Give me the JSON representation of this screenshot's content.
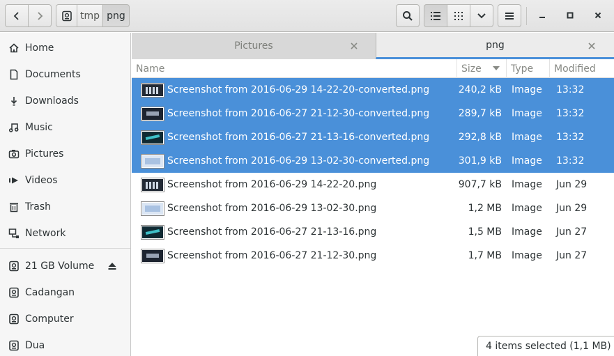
{
  "header": {
    "back_icon": "chevron-left-icon",
    "forward_icon": "chevron-right-icon",
    "path": [
      "tmp",
      "png"
    ],
    "path_root_icon": "drive-icon",
    "search_icon": "search-icon",
    "list_view_icon": "list-icon",
    "grid_view_icon": "grid-icon",
    "view_options_icon": "chevron-down-icon",
    "menu_icon": "hamburger-icon"
  },
  "sidebar": {
    "places": [
      {
        "label": "Home",
        "icon": "home-icon"
      },
      {
        "label": "Documents",
        "icon": "document-icon"
      },
      {
        "label": "Downloads",
        "icon": "download-icon"
      },
      {
        "label": "Music",
        "icon": "music-icon"
      },
      {
        "label": "Pictures",
        "icon": "camera-icon"
      },
      {
        "label": "Videos",
        "icon": "video-icon"
      },
      {
        "label": "Trash",
        "icon": "trash-icon"
      },
      {
        "label": "Network",
        "icon": "network-icon"
      }
    ],
    "devices": [
      {
        "label": "21 GB Volume",
        "icon": "drive-icon",
        "eject": true
      },
      {
        "label": "Cadangan",
        "icon": "drive-icon"
      },
      {
        "label": "Computer",
        "icon": "drive-icon"
      },
      {
        "label": "Dua",
        "icon": "drive-icon"
      }
    ]
  },
  "tabs": [
    {
      "label": "Pictures",
      "active": false
    },
    {
      "label": "png",
      "active": true
    }
  ],
  "columns": {
    "name": "Name",
    "size": "Size",
    "type": "Type",
    "modified": "Modified"
  },
  "files": [
    {
      "name": "Screenshot from 2016-06-29 14-22-20-converted.png",
      "size": "240,2 kB",
      "type": "Image",
      "modified": "13:32",
      "selected": true,
      "thumb": "grid"
    },
    {
      "name": "Screenshot from 2016-06-27 21-12-30-converted.png",
      "size": "289,7 kB",
      "type": "Image",
      "modified": "13:32",
      "selected": true,
      "thumb": "dark"
    },
    {
      "name": "Screenshot from 2016-06-27 21-13-16-converted.png",
      "size": "292,8 kB",
      "type": "Image",
      "modified": "13:32",
      "selected": true,
      "thumb": "teal"
    },
    {
      "name": "Screenshot from 2016-06-29 13-02-30-converted.png",
      "size": "301,9 kB",
      "type": "Image",
      "modified": "13:32",
      "selected": true,
      "thumb": "light"
    },
    {
      "name": "Screenshot from 2016-06-29 14-22-20.png",
      "size": "907,7 kB",
      "type": "Image",
      "modified": "Jun 29",
      "selected": false,
      "thumb": "grid"
    },
    {
      "name": "Screenshot from 2016-06-29 13-02-30.png",
      "size": "1,2 MB",
      "type": "Image",
      "modified": "Jun 29",
      "selected": false,
      "thumb": "light"
    },
    {
      "name": "Screenshot from 2016-06-27 21-13-16.png",
      "size": "1,5 MB",
      "type": "Image",
      "modified": "Jun 27",
      "selected": false,
      "thumb": "teal"
    },
    {
      "name": "Screenshot from 2016-06-27 21-12-30.png",
      "size": "1,7 MB",
      "type": "Image",
      "modified": "Jun 27",
      "selected": false,
      "thumb": "dark"
    }
  ],
  "status": "4 items selected (1,1 MB)",
  "colors": {
    "selection": "#4a90d9",
    "sidebar_bg": "#f6f6f6"
  }
}
